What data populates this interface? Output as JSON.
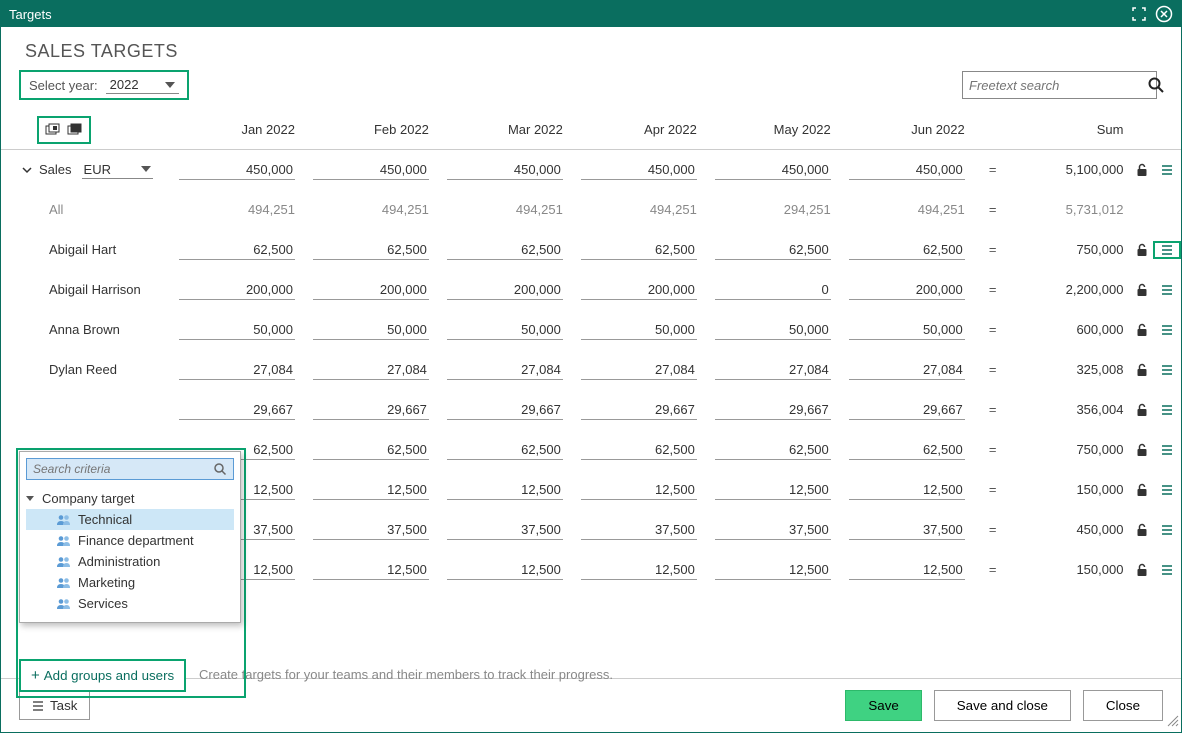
{
  "titlebar": {
    "title": "Targets"
  },
  "heading": "SALES TARGETS",
  "year_select": {
    "label": "Select year:",
    "value": "2022"
  },
  "search": {
    "placeholder": "Freetext search"
  },
  "columns": [
    "Jan 2022",
    "Feb 2022",
    "Mar 2022",
    "Apr 2022",
    "May 2022",
    "Jun 2022"
  ],
  "sum_header": "Sum",
  "sales_group": {
    "label": "Sales",
    "currency": "EUR"
  },
  "rows": [
    {
      "label": "",
      "values": [
        "450,000",
        "450,000",
        "450,000",
        "450,000",
        "450,000",
        "450,000"
      ],
      "sum": "5,100,000",
      "lock": true,
      "menu": true,
      "faded": false,
      "header": true
    },
    {
      "label": "All",
      "values": [
        "494,251",
        "494,251",
        "494,251",
        "494,251",
        "294,251",
        "494,251"
      ],
      "sum": "5,731,012",
      "lock": false,
      "menu": false,
      "faded": true
    },
    {
      "label": "Abigail Hart",
      "values": [
        "62,500",
        "62,500",
        "62,500",
        "62,500",
        "62,500",
        "62,500"
      ],
      "sum": "750,000",
      "lock": true,
      "menu": true,
      "menu_hl": true
    },
    {
      "label": "Abigail Harrison",
      "values": [
        "200,000",
        "200,000",
        "200,000",
        "200,000",
        "0",
        "200,000"
      ],
      "sum": "2,200,000",
      "lock": true,
      "menu": true
    },
    {
      "label": "Anna Brown",
      "values": [
        "50,000",
        "50,000",
        "50,000",
        "50,000",
        "50,000",
        "50,000"
      ],
      "sum": "600,000",
      "lock": true,
      "menu": true
    },
    {
      "label": "Dylan Reed",
      "values": [
        "27,084",
        "27,084",
        "27,084",
        "27,084",
        "27,084",
        "27,084"
      ],
      "sum": "325,008",
      "lock": true,
      "menu": true
    },
    {
      "label": "",
      "values": [
        "29,667",
        "29,667",
        "29,667",
        "29,667",
        "29,667",
        "29,667"
      ],
      "sum": "356,004",
      "lock": true,
      "menu": true
    },
    {
      "label": "",
      "values": [
        "62,500",
        "62,500",
        "62,500",
        "62,500",
        "62,500",
        "62,500"
      ],
      "sum": "750,000",
      "lock": true,
      "menu": true
    },
    {
      "label": "",
      "values": [
        "12,500",
        "12,500",
        "12,500",
        "12,500",
        "12,500",
        "12,500"
      ],
      "sum": "150,000",
      "lock": true,
      "menu": true
    },
    {
      "label": "",
      "values": [
        "37,500",
        "37,500",
        "37,500",
        "37,500",
        "37,500",
        "37,500"
      ],
      "sum": "450,000",
      "lock": true,
      "menu": true
    },
    {
      "label": "",
      "values": [
        "12,500",
        "12,500",
        "12,500",
        "12,500",
        "12,500",
        "12,500"
      ],
      "sum": "150,000",
      "lock": true,
      "menu": true
    }
  ],
  "popup": {
    "search_placeholder": "Search criteria",
    "root": "Company target",
    "children": [
      "Technical",
      "Finance department",
      "Administration",
      "Marketing",
      "Services"
    ],
    "selected_index": 0
  },
  "add_groups": "Add groups and users",
  "hint": "Create targets for your teams and their members to track their progress.",
  "footer": {
    "task": "Task",
    "save": "Save",
    "save_close": "Save and close",
    "close": "Close"
  }
}
